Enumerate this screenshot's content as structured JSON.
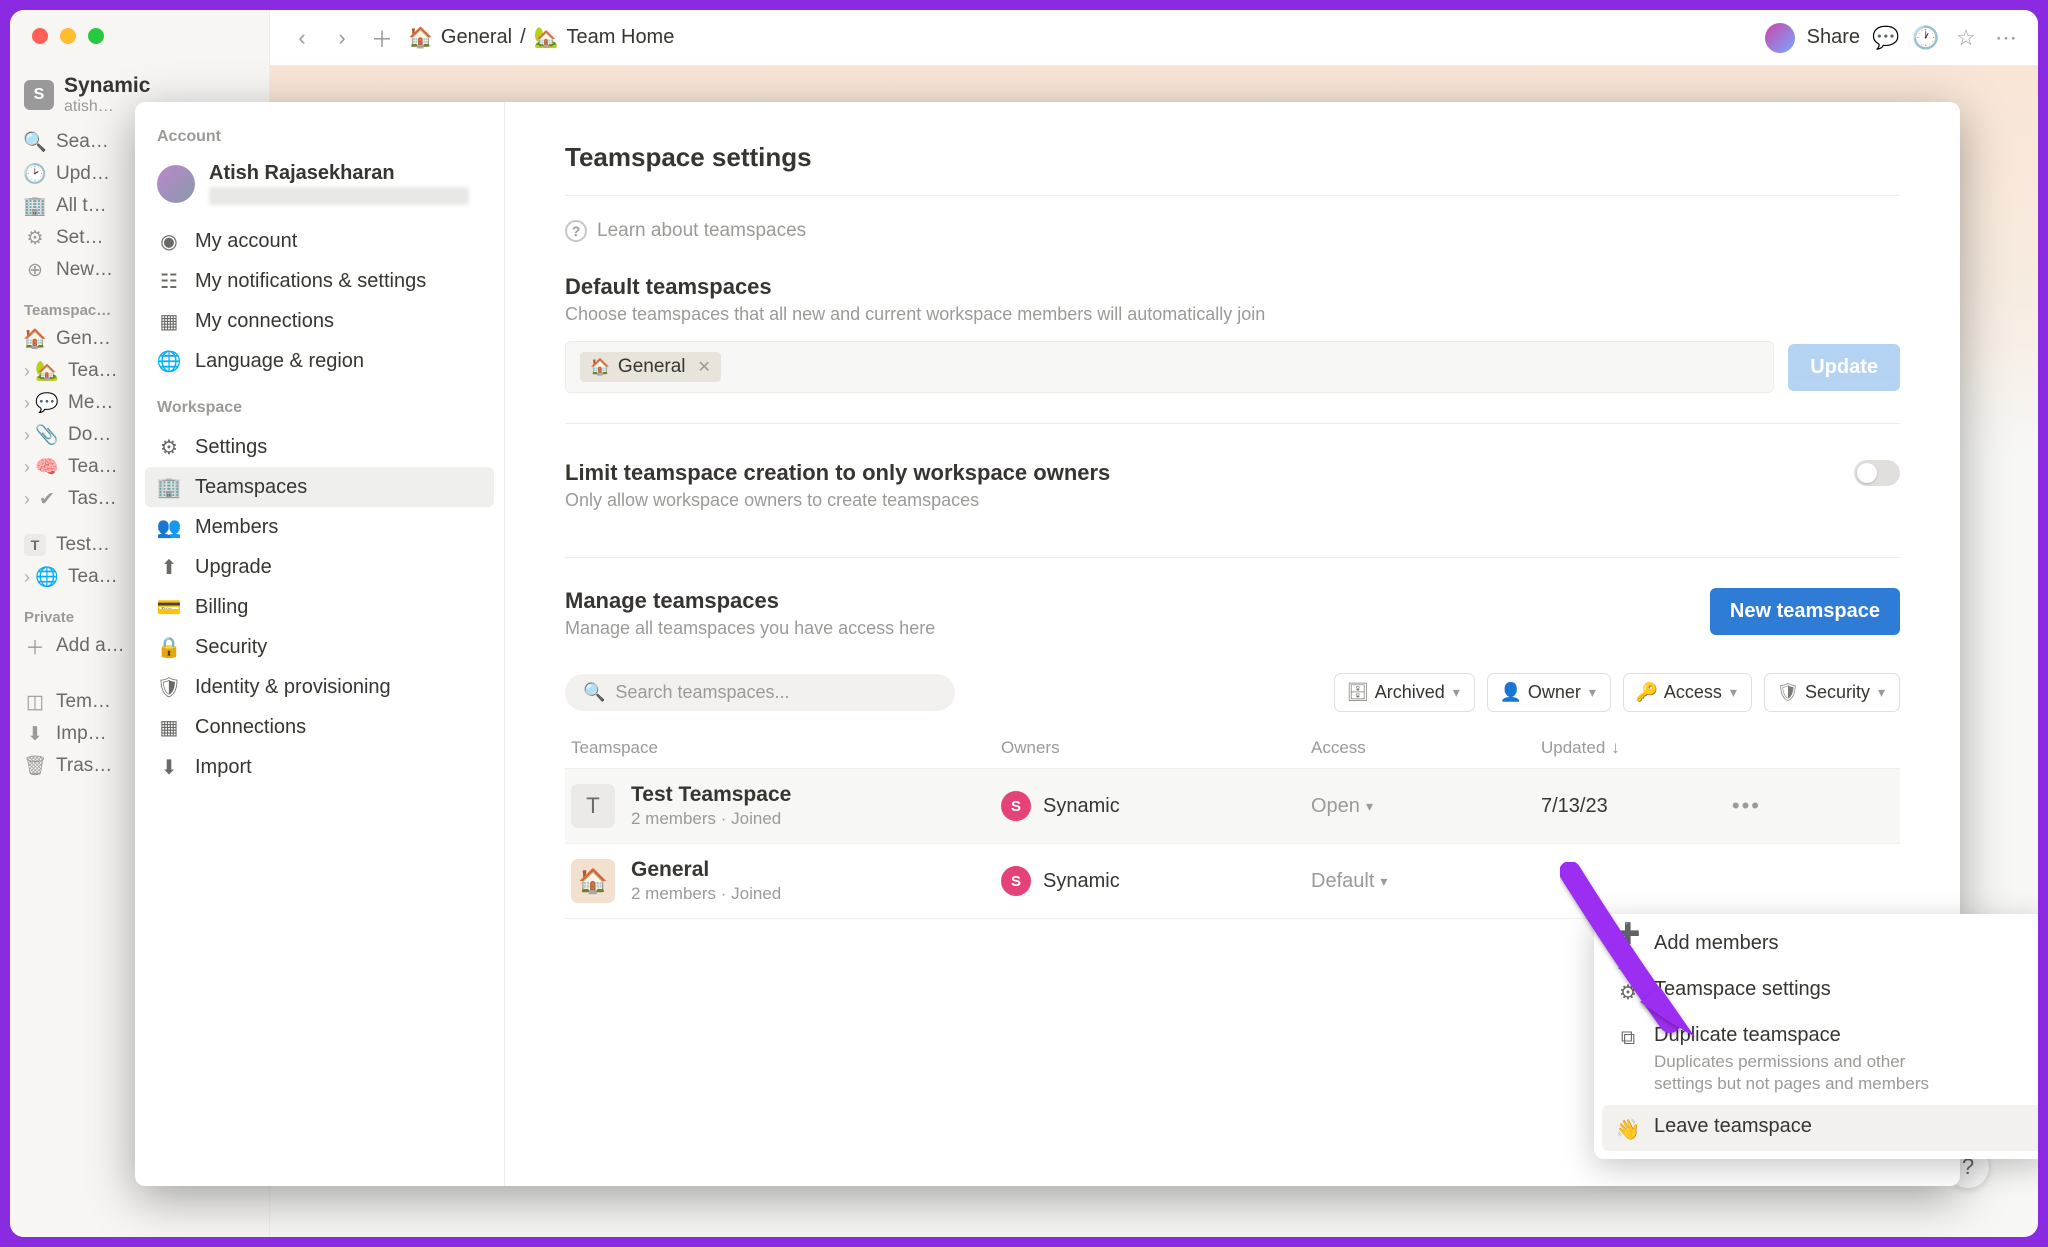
{
  "window": {
    "workspace_letter": "S",
    "workspace_name": "Synamic",
    "workspace_sub": "atish…"
  },
  "rail": {
    "search": "Sea…",
    "updates": "Upd…",
    "all": "All t…",
    "settings": "Set…",
    "new": "New…",
    "section_teamspaces": "Teamspac…",
    "ts_general": "Gen…",
    "ts_team": "Tea…",
    "ts_me": "Me…",
    "ts_do": "Do…",
    "ts_tea2": "Tea…",
    "ts_tas": "Tas…",
    "test_ts": "Test…",
    "team_wiki": "Tea…",
    "section_private": "Private",
    "add_page": "Add a…",
    "templates": "Tem…",
    "import": "Imp…",
    "trash": "Tras…"
  },
  "topbar": {
    "crumb_workspace": "General",
    "crumb_sep": "/",
    "crumb_page": "Team Home",
    "share": "Share"
  },
  "modal": {
    "sections": {
      "account": "Account",
      "workspace": "Workspace"
    },
    "profile_name": "Atish Rajasekharan",
    "account_items": {
      "my_account": "My account",
      "notifications": "My notifications & settings",
      "connections": "My connections",
      "language": "Language & region"
    },
    "workspace_items": {
      "settings": "Settings",
      "teamspaces": "Teamspaces",
      "members": "Members",
      "upgrade": "Upgrade",
      "billing": "Billing",
      "security": "Security",
      "identity": "Identity & provisioning",
      "connections": "Connections",
      "import": "Import"
    }
  },
  "main": {
    "title": "Teamspace settings",
    "learn": "Learn about teamspaces",
    "default_h": "Default teamspaces",
    "default_sub": "Choose teamspaces that all new and current workspace members will automatically join",
    "default_chip": "General",
    "update_btn": "Update",
    "limit_h": "Limit teamspace creation to only workspace owners",
    "limit_sub": "Only allow workspace owners to create teamspaces",
    "manage_h": "Manage teamspaces",
    "manage_sub": "Manage all teamspaces you have access here",
    "new_ts_btn": "New teamspace",
    "search_placeholder": "Search teamspaces...",
    "filters": {
      "archived": "Archived",
      "owner": "Owner",
      "access": "Access",
      "security": "Security"
    },
    "columns": {
      "teamspace": "Teamspace",
      "owners": "Owners",
      "access": "Access",
      "updated": "Updated"
    },
    "rows": [
      {
        "icon_letter": "T",
        "icon_style": "gray",
        "name": "Test Teamspace",
        "meta": "2 members  ·  Joined",
        "owner_letter": "S",
        "owner_name": "Synamic",
        "access": "Open",
        "updated": "7/13/23"
      },
      {
        "icon_letter": "🏠",
        "icon_style": "orange",
        "name": "General",
        "meta": "2 members  ·  Joined",
        "owner_letter": "S",
        "owner_name": "Synamic",
        "access": "Default",
        "updated": ""
      }
    ]
  },
  "context_menu": {
    "add_members": "Add members",
    "ts_settings": "Teamspace settings",
    "duplicate": "Duplicate teamspace",
    "duplicate_sub1": "Duplicates permissions and other",
    "duplicate_sub2": "settings but not pages and members",
    "leave": "Leave teamspace"
  }
}
